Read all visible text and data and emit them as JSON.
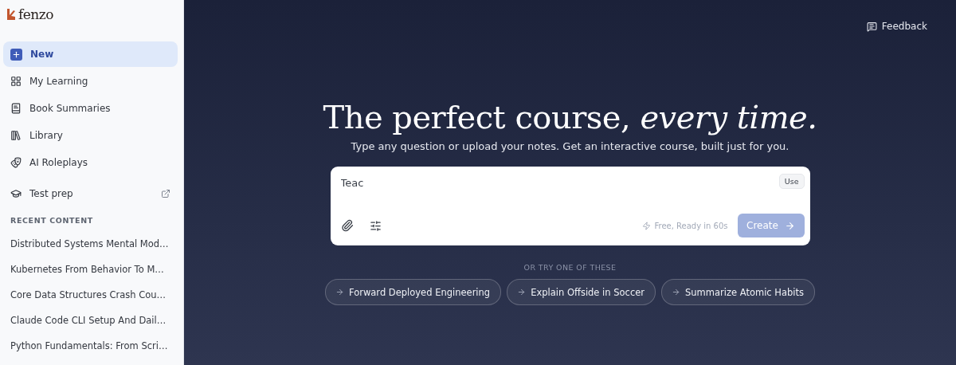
{
  "sidebar": {
    "logo": "fenzo",
    "nav": [
      {
        "label": "New",
        "selected": true,
        "kind": "new"
      },
      {
        "label": "My Learning",
        "selected": false,
        "kind": "nav"
      },
      {
        "label": "Book Summaries",
        "selected": false,
        "kind": "nav"
      },
      {
        "label": "Library",
        "selected": false,
        "kind": "nav"
      },
      {
        "label": "AI Roleplays",
        "selected": false,
        "kind": "nav"
      },
      {
        "label": "Test prep",
        "selected": false,
        "kind": "external"
      }
    ],
    "recent_heading": "RECENT CONTENT",
    "recent": [
      "Distributed Systems Mental Mod…",
      "Kubernetes From Behavior To M…",
      "Core Data Structures Crash Cou…",
      "Claude Code CLI Setup And Dail…",
      "Python Fundamentals: From Scri…"
    ]
  },
  "feedback": "Feedback",
  "hero": {
    "title": "The perfect course, *every time.*",
    "subtitle": "Type any question or upload your notes. Get an interactive course, built just for you."
  },
  "composer": {
    "value": "Teac",
    "use_button": "Use",
    "note": "Free, Ready in 60s",
    "create": {
      "label": "Create",
      "disabled": true
    }
  },
  "suggestions": {
    "heading": "OR TRY ONE OF THESE",
    "items": [
      "Forward Deployed Engineering",
      "Explain Offside in Soccer",
      "Summarize Atomic Habits"
    ]
  }
}
